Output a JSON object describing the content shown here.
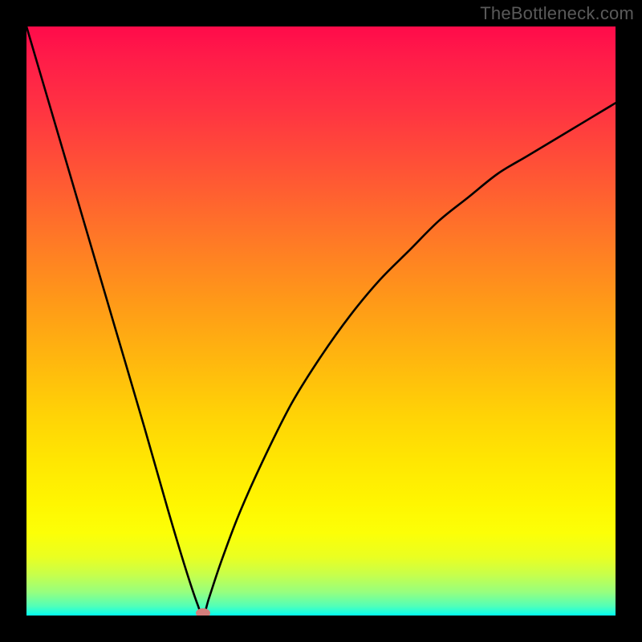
{
  "watermark": "TheBottleneck.com",
  "colors": {
    "frame_bg": "#000000",
    "watermark": "#5a5a5a",
    "curve": "#000000",
    "marker_fill": "#d47e7c",
    "gradient_stops": [
      {
        "offset": 0.0,
        "color": "#ff0b4a"
      },
      {
        "offset": 0.05,
        "color": "#ff1b49"
      },
      {
        "offset": 0.14,
        "color": "#ff3342"
      },
      {
        "offset": 0.24,
        "color": "#ff5236"
      },
      {
        "offset": 0.35,
        "color": "#ff7528"
      },
      {
        "offset": 0.46,
        "color": "#ff9719"
      },
      {
        "offset": 0.57,
        "color": "#ffb80e"
      },
      {
        "offset": 0.66,
        "color": "#ffd306"
      },
      {
        "offset": 0.74,
        "color": "#ffe702"
      },
      {
        "offset": 0.81,
        "color": "#fff601"
      },
      {
        "offset": 0.86,
        "color": "#fcff07"
      },
      {
        "offset": 0.9,
        "color": "#eaff21"
      },
      {
        "offset": 0.93,
        "color": "#c8ff4a"
      },
      {
        "offset": 0.96,
        "color": "#97ff7e"
      },
      {
        "offset": 0.984,
        "color": "#52ffb8"
      },
      {
        "offset": 1.0,
        "color": "#03ffef"
      }
    ]
  },
  "chart_data": {
    "type": "line",
    "title": "",
    "xlabel": "",
    "ylabel": "",
    "xlim": [
      0,
      100
    ],
    "ylim": [
      0,
      100
    ],
    "notes": "V-shaped bottleneck curve: minimum (~0) at x≈30; left branch rises steeply to 100 at x=0; right branch rises asymptotically toward ~87 at x=100. Marker at the minimum.",
    "series": [
      {
        "name": "bottleneck-curve",
        "x": [
          0,
          5,
          10,
          15,
          20,
          24,
          27,
          29,
          30,
          31,
          33,
          36,
          40,
          45,
          50,
          55,
          60,
          65,
          70,
          75,
          80,
          85,
          90,
          95,
          100
        ],
        "values": [
          100,
          83,
          66,
          49,
          32,
          18,
          8,
          2,
          0,
          3,
          9,
          17,
          26,
          36,
          44,
          51,
          57,
          62,
          67,
          71,
          75,
          78,
          81,
          84,
          87
        ]
      }
    ],
    "marker": {
      "x": 30,
      "y": 0,
      "shape": "ellipse"
    }
  }
}
